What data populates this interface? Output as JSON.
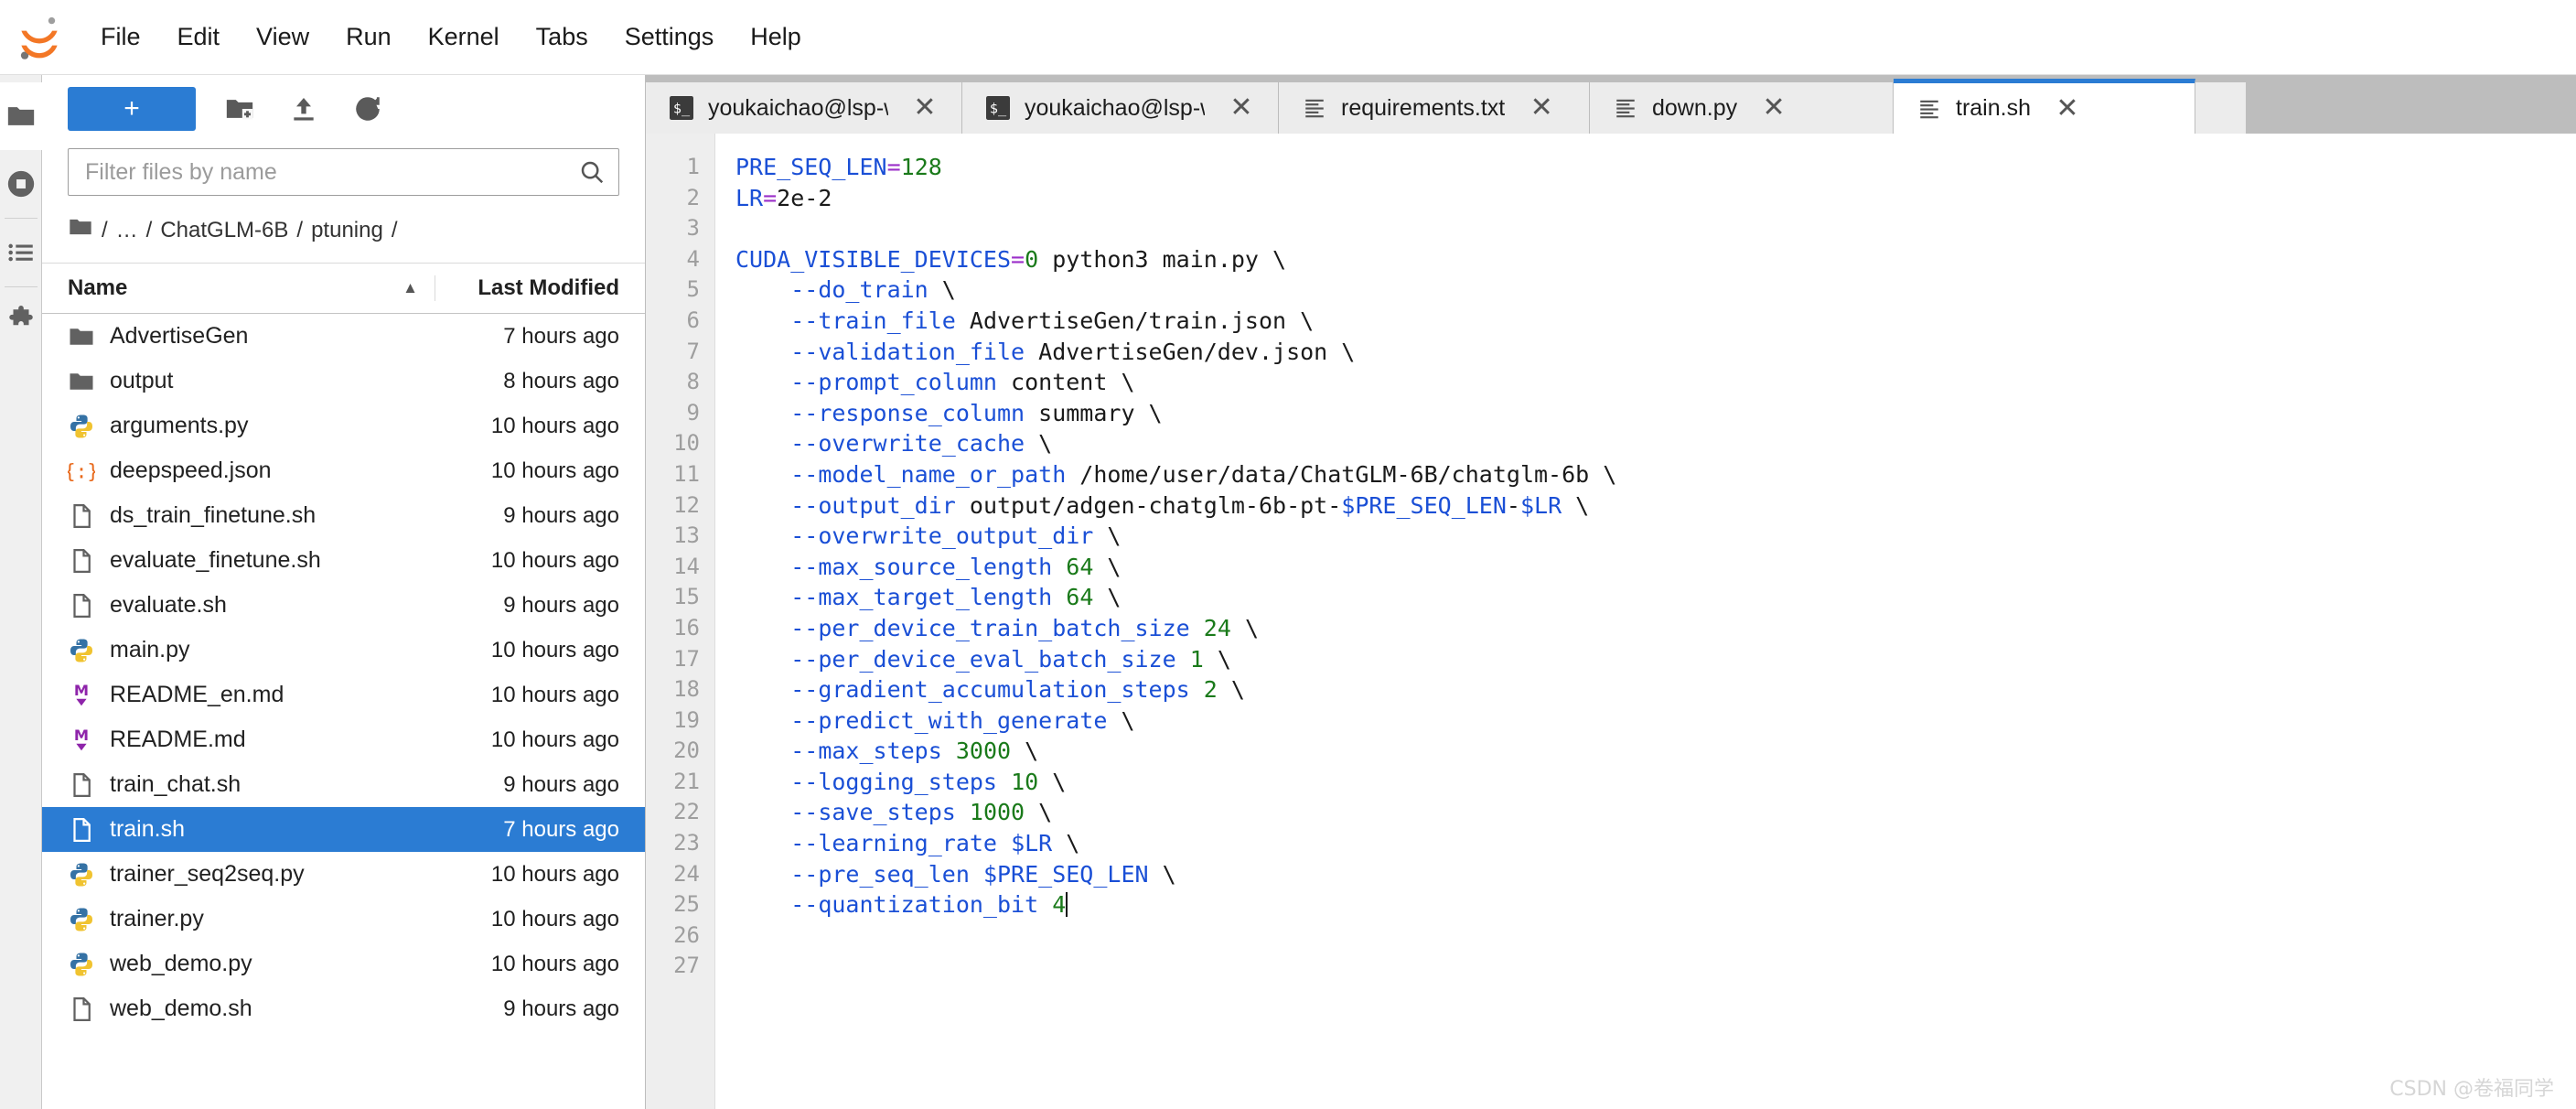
{
  "menubar": {
    "logo_icon": "jupyter-logo-icon",
    "items": [
      {
        "label": "File"
      },
      {
        "label": "Edit"
      },
      {
        "label": "View"
      },
      {
        "label": "Run"
      },
      {
        "label": "Kernel"
      },
      {
        "label": "Tabs"
      },
      {
        "label": "Settings"
      },
      {
        "label": "Help"
      }
    ]
  },
  "activitybar": {
    "items": [
      {
        "name": "file-browser",
        "icon": "folder-icon",
        "active": true
      },
      {
        "name": "running-terminals",
        "icon": "stop-circle-icon",
        "active": false
      },
      {
        "name": "command-palette",
        "icon": "list-icon",
        "active": false
      },
      {
        "name": "extension-manager",
        "icon": "puzzle-icon",
        "active": false
      }
    ]
  },
  "filebrowser": {
    "toolbar": {
      "new_launcher_label": "+",
      "new_folder_icon": "new-folder-icon",
      "upload_icon": "upload-icon",
      "refresh_icon": "refresh-icon"
    },
    "filter": {
      "placeholder": "Filter files by name",
      "value": "",
      "icon": "search-icon"
    },
    "breadcrumb": {
      "home_icon": "folder-icon",
      "segments": [
        "/",
        "…",
        "/",
        "ChatGLM-6B",
        "/",
        "ptuning",
        "/"
      ]
    },
    "columns": {
      "name": "Name",
      "last_modified": "Last Modified",
      "sort_caret": "▲"
    },
    "rows": [
      {
        "name": "AdvertiseGen",
        "modified": "7 hours ago",
        "icon": "folder-icon",
        "selected": false
      },
      {
        "name": "output",
        "modified": "8 hours ago",
        "icon": "folder-icon",
        "selected": false
      },
      {
        "name": "arguments.py",
        "modified": "10 hours ago",
        "icon": "python-icon",
        "selected": false
      },
      {
        "name": "deepspeed.json",
        "modified": "10 hours ago",
        "icon": "json-icon",
        "selected": false
      },
      {
        "name": "ds_train_finetune.sh",
        "modified": "9 hours ago",
        "icon": "file-icon",
        "selected": false
      },
      {
        "name": "evaluate_finetune.sh",
        "modified": "10 hours ago",
        "icon": "file-icon",
        "selected": false
      },
      {
        "name": "evaluate.sh",
        "modified": "9 hours ago",
        "icon": "file-icon",
        "selected": false
      },
      {
        "name": "main.py",
        "modified": "10 hours ago",
        "icon": "python-icon",
        "selected": false
      },
      {
        "name": "README_en.md",
        "modified": "10 hours ago",
        "icon": "markdown-icon",
        "selected": false
      },
      {
        "name": "README.md",
        "modified": "10 hours ago",
        "icon": "markdown-icon",
        "selected": false
      },
      {
        "name": "train_chat.sh",
        "modified": "9 hours ago",
        "icon": "file-icon",
        "selected": false
      },
      {
        "name": "train.sh",
        "modified": "7 hours ago",
        "icon": "file-icon",
        "selected": true
      },
      {
        "name": "trainer_seq2seq.py",
        "modified": "10 hours ago",
        "icon": "python-icon",
        "selected": false
      },
      {
        "name": "trainer.py",
        "modified": "10 hours ago",
        "icon": "python-icon",
        "selected": false
      },
      {
        "name": "web_demo.py",
        "modified": "10 hours ago",
        "icon": "python-icon",
        "selected": false
      },
      {
        "name": "web_demo.sh",
        "modified": "9 hours ago",
        "icon": "file-icon",
        "selected": false
      }
    ]
  },
  "tabs": [
    {
      "label": "youkaichao@lsp-ws:/hom",
      "icon": "terminal-icon",
      "close": "✕",
      "active": false,
      "cls": "t-term"
    },
    {
      "label": "youkaichao@lsp-ws:/hom",
      "icon": "terminal-icon",
      "close": "✕",
      "active": false,
      "cls": "t-term"
    },
    {
      "label": "requirements.txt",
      "icon": "text-file-icon",
      "close": "✕",
      "active": false,
      "cls": "t-req"
    },
    {
      "label": "down.py",
      "icon": "text-file-icon",
      "close": "✕",
      "active": false,
      "cls": "t-down"
    },
    {
      "label": "train.sh",
      "icon": "text-file-icon",
      "close": "✕",
      "active": true,
      "cls": "t-train"
    }
  ],
  "editor": {
    "line_numbers": [
      1,
      2,
      3,
      4,
      5,
      6,
      7,
      8,
      9,
      10,
      11,
      12,
      13,
      14,
      15,
      16,
      17,
      18,
      19,
      20,
      21,
      22,
      23,
      24,
      25,
      26,
      27
    ],
    "lines": [
      [
        {
          "t": "PRE_SEQ_LEN",
          "c": "var"
        },
        {
          "t": "=",
          "c": "op"
        },
        {
          "t": "128",
          "c": "num"
        }
      ],
      [
        {
          "t": "LR",
          "c": "var"
        },
        {
          "t": "=",
          "c": "op"
        },
        {
          "t": "2e-2",
          "c": "txt"
        }
      ],
      [],
      [
        {
          "t": "CUDA_VISIBLE_DEVICES",
          "c": "var"
        },
        {
          "t": "=",
          "c": "op"
        },
        {
          "t": "0",
          "c": "num"
        },
        {
          "t": " python3 main.py \\",
          "c": "txt"
        }
      ],
      [
        {
          "t": "    ",
          "c": "txt"
        },
        {
          "t": "--do_train",
          "c": "flag"
        },
        {
          "t": " \\",
          "c": "txt"
        }
      ],
      [
        {
          "t": "    ",
          "c": "txt"
        },
        {
          "t": "--train_file",
          "c": "flag"
        },
        {
          "t": " AdvertiseGen/train.json \\",
          "c": "txt"
        }
      ],
      [
        {
          "t": "    ",
          "c": "txt"
        },
        {
          "t": "--validation_file",
          "c": "flag"
        },
        {
          "t": " AdvertiseGen/dev.json \\",
          "c": "txt"
        }
      ],
      [
        {
          "t": "    ",
          "c": "txt"
        },
        {
          "t": "--prompt_column",
          "c": "flag"
        },
        {
          "t": " content \\",
          "c": "txt"
        }
      ],
      [
        {
          "t": "    ",
          "c": "txt"
        },
        {
          "t": "--response_column",
          "c": "flag"
        },
        {
          "t": " summary \\",
          "c": "txt"
        }
      ],
      [
        {
          "t": "    ",
          "c": "txt"
        },
        {
          "t": "--overwrite_cache",
          "c": "flag"
        },
        {
          "t": " \\",
          "c": "txt"
        }
      ],
      [
        {
          "t": "    ",
          "c": "txt"
        },
        {
          "t": "--model_name_or_path",
          "c": "flag"
        },
        {
          "t": " /home/user/data/ChatGLM-6B/chatglm-6b \\",
          "c": "txt"
        }
      ],
      [
        {
          "t": "    ",
          "c": "txt"
        },
        {
          "t": "--output_dir",
          "c": "flag"
        },
        {
          "t": " output/adgen-chatglm-6b-pt-",
          "c": "txt"
        },
        {
          "t": "$PRE_SEQ_LEN",
          "c": "var"
        },
        {
          "t": "-",
          "c": "txt"
        },
        {
          "t": "$LR",
          "c": "var"
        },
        {
          "t": " \\",
          "c": "txt"
        }
      ],
      [
        {
          "t": "    ",
          "c": "txt"
        },
        {
          "t": "--overwrite_output_dir",
          "c": "flag"
        },
        {
          "t": " \\",
          "c": "txt"
        }
      ],
      [
        {
          "t": "    ",
          "c": "txt"
        },
        {
          "t": "--max_source_length",
          "c": "flag"
        },
        {
          "t": " ",
          "c": "txt"
        },
        {
          "t": "64",
          "c": "num"
        },
        {
          "t": " \\",
          "c": "txt"
        }
      ],
      [
        {
          "t": "    ",
          "c": "txt"
        },
        {
          "t": "--max_target_length",
          "c": "flag"
        },
        {
          "t": " ",
          "c": "txt"
        },
        {
          "t": "64",
          "c": "num"
        },
        {
          "t": " \\",
          "c": "txt"
        }
      ],
      [
        {
          "t": "    ",
          "c": "txt"
        },
        {
          "t": "--per_device_train_batch_size",
          "c": "flag"
        },
        {
          "t": " ",
          "c": "txt"
        },
        {
          "t": "24",
          "c": "num"
        },
        {
          "t": " \\",
          "c": "txt"
        }
      ],
      [
        {
          "t": "    ",
          "c": "txt"
        },
        {
          "t": "--per_device_eval_batch_size",
          "c": "flag"
        },
        {
          "t": " ",
          "c": "txt"
        },
        {
          "t": "1",
          "c": "num"
        },
        {
          "t": " \\",
          "c": "txt"
        }
      ],
      [
        {
          "t": "    ",
          "c": "txt"
        },
        {
          "t": "--gradient_accumulation_steps",
          "c": "flag"
        },
        {
          "t": " ",
          "c": "txt"
        },
        {
          "t": "2",
          "c": "num"
        },
        {
          "t": " \\",
          "c": "txt"
        }
      ],
      [
        {
          "t": "    ",
          "c": "txt"
        },
        {
          "t": "--predict_with_generate",
          "c": "flag"
        },
        {
          "t": " \\",
          "c": "txt"
        }
      ],
      [
        {
          "t": "    ",
          "c": "txt"
        },
        {
          "t": "--max_steps",
          "c": "flag"
        },
        {
          "t": " ",
          "c": "txt"
        },
        {
          "t": "3000",
          "c": "num"
        },
        {
          "t": " \\",
          "c": "txt"
        }
      ],
      [
        {
          "t": "    ",
          "c": "txt"
        },
        {
          "t": "--logging_steps",
          "c": "flag"
        },
        {
          "t": " ",
          "c": "txt"
        },
        {
          "t": "10",
          "c": "num"
        },
        {
          "t": " \\",
          "c": "txt"
        }
      ],
      [
        {
          "t": "    ",
          "c": "txt"
        },
        {
          "t": "--save_steps",
          "c": "flag"
        },
        {
          "t": " ",
          "c": "txt"
        },
        {
          "t": "1000",
          "c": "num"
        },
        {
          "t": " \\",
          "c": "txt"
        }
      ],
      [
        {
          "t": "    ",
          "c": "txt"
        },
        {
          "t": "--learning_rate",
          "c": "flag"
        },
        {
          "t": " ",
          "c": "txt"
        },
        {
          "t": "$LR",
          "c": "var"
        },
        {
          "t": " \\",
          "c": "txt"
        }
      ],
      [
        {
          "t": "    ",
          "c": "txt"
        },
        {
          "t": "--pre_seq_len",
          "c": "flag"
        },
        {
          "t": " ",
          "c": "txt"
        },
        {
          "t": "$PRE_SEQ_LEN",
          "c": "var"
        },
        {
          "t": " \\",
          "c": "txt"
        }
      ],
      [
        {
          "t": "    ",
          "c": "txt"
        },
        {
          "t": "--quantization_bit",
          "c": "flag"
        },
        {
          "t": " ",
          "c": "txt"
        },
        {
          "t": "4",
          "c": "num"
        },
        {
          "t": "|CARET|",
          "c": "caret"
        }
      ],
      [],
      []
    ]
  },
  "watermark": "CSDN @卷福同学",
  "colors": {
    "accent": "#2b7cd3",
    "tabbar_bg": "#bdbdbd",
    "gutter_bg": "#eeeeee",
    "keyword_blue": "#1a4fd6",
    "operator_purple": "#9b2fc9",
    "number_green": "#1a7a1a"
  }
}
